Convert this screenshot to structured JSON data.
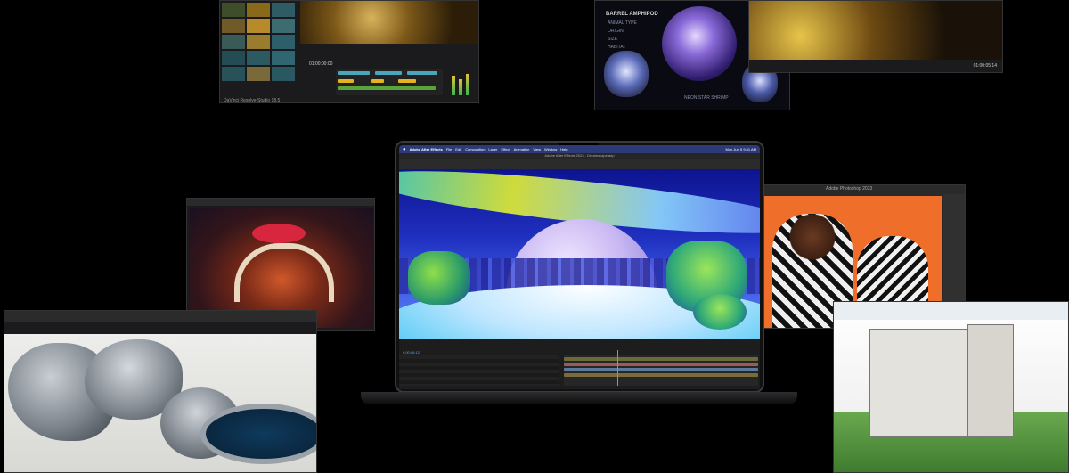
{
  "resolve_window": {
    "caption": "DaVinci Resolve Studio 18.5",
    "timecode": "01:00:00:00"
  },
  "nuke_window": {
    "heading": "BARREL AMPHIPOD",
    "specimen_labels": [
      "ANIMAL TYPE",
      "ORIGIN",
      "SIZE",
      "HABITAT"
    ],
    "caption": "NEON STAR SHRIMP"
  },
  "editor_window": {
    "timecode": "01:00:05:14"
  },
  "after_effects": {
    "menu": [
      "Adobe After Effects",
      "File",
      "Edit",
      "Composition",
      "Layer",
      "Effect",
      "Animation",
      "View",
      "Window",
      "Help"
    ],
    "clock": "Mon Jun 5  9:41 AM",
    "window_title": "Adobe After Effects 2023 - Dreamscape.aep",
    "timecode": "0;00;06;12"
  },
  "photoshop": {
    "title": "Adobe Photoshop 2023"
  },
  "colors": {
    "sky_deep": "#1320a8",
    "sky_mid": "#3e5fe6",
    "aurora": "#e4f030",
    "planet": "#c9b8f2",
    "ps_background": "#ef6f2a"
  }
}
